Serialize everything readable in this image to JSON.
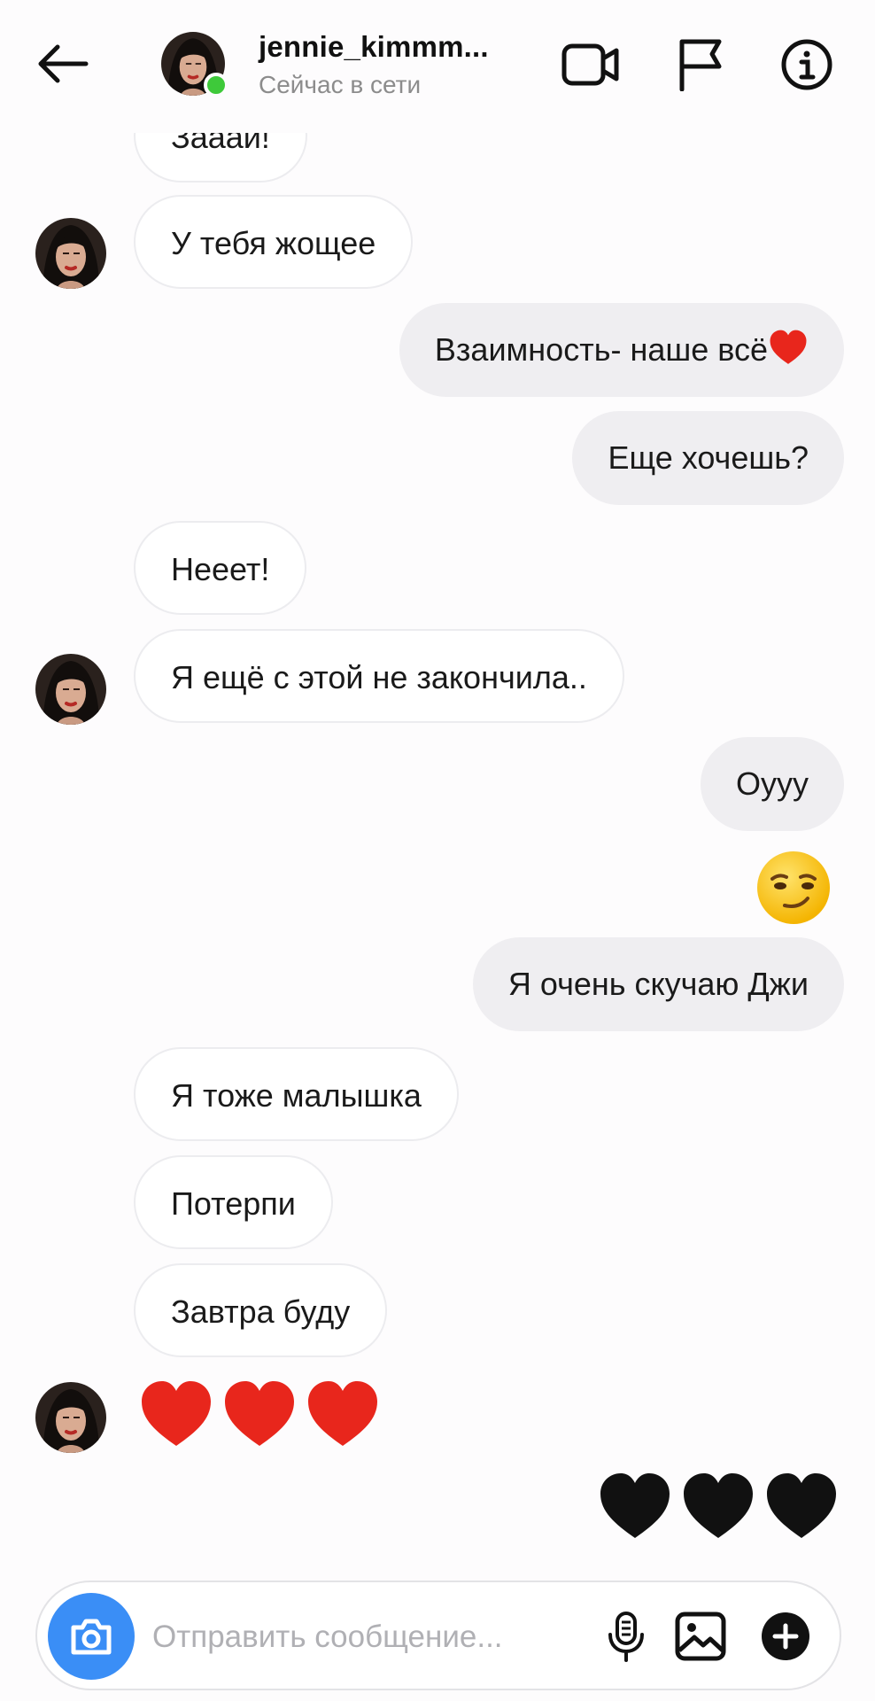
{
  "header": {
    "username": "jennie_kimmm...",
    "status": "Сейчас в сети"
  },
  "icons": {
    "back": "back-arrow-icon",
    "video": "video-call-icon",
    "flag": "flag-icon",
    "info": "info-icon",
    "camera": "camera-icon",
    "mic": "microphone-icon",
    "gallery": "gallery-icon",
    "plus": "plus-icon"
  },
  "colors": {
    "online": "#3ec93a",
    "camera_button": "#3a8ef6",
    "outgoing_bubble": "#efeef1",
    "red_heart": "#e8261c",
    "black_heart": "#111111"
  },
  "messages": [
    {
      "id": "m0",
      "side": "in",
      "text": "Зааай!"
    },
    {
      "id": "m1",
      "side": "in",
      "text": "У тебя жощее"
    },
    {
      "id": "m2",
      "side": "out",
      "text": "Взаимность- наше всё"
    },
    {
      "id": "m3",
      "side": "out",
      "text": "Еще хочешь?"
    },
    {
      "id": "m4",
      "side": "in",
      "text": "Нееет!"
    },
    {
      "id": "m5",
      "side": "in",
      "text": "Я ещё с этой не закончила.."
    },
    {
      "id": "m6",
      "side": "out",
      "text": "Оууу"
    },
    {
      "id": "m7",
      "side": "out",
      "emoji": "smirking-face"
    },
    {
      "id": "m8",
      "side": "out",
      "text": "Я очень скучаю Джи"
    },
    {
      "id": "m9",
      "side": "in",
      "text": "Я тоже малышка"
    },
    {
      "id": "m10",
      "side": "in",
      "text": "Потерпи"
    },
    {
      "id": "m11",
      "side": "in",
      "text": "Завтра буду"
    },
    {
      "id": "m12",
      "side": "in",
      "emoji": "three-red-hearts"
    },
    {
      "id": "m13",
      "side": "out",
      "emoji": "three-black-hearts"
    }
  ],
  "composer": {
    "placeholder": "Отправить сообщение..."
  }
}
